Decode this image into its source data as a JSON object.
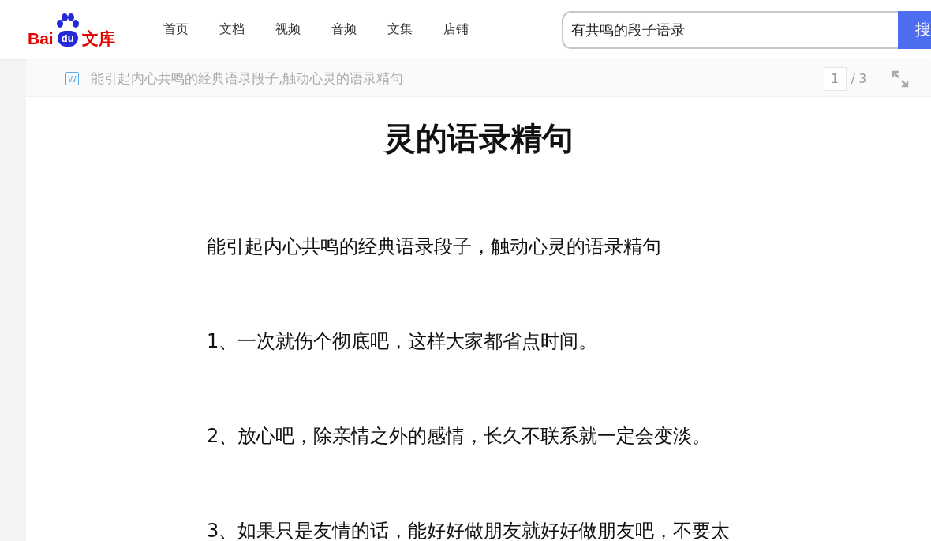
{
  "logo": {
    "latin": "Bai",
    "paw_text": "du",
    "name": "文库"
  },
  "nav": [
    {
      "label": "首页"
    },
    {
      "label": "文档"
    },
    {
      "label": "视频"
    },
    {
      "label": "音频"
    },
    {
      "label": "文集"
    },
    {
      "label": "店铺"
    }
  ],
  "search": {
    "value": "有共鸣的段子语录",
    "button": "搜"
  },
  "doc_bar": {
    "file_badge": "W",
    "title": "能引起内心共鸣的经典语录段子,触动心灵的语录精句",
    "page": "1",
    "pages": "/ 3"
  },
  "document": {
    "heading": "灵的语录精句",
    "paragraphs": [
      "能引起内心共鸣的经典语录段子，触动心灵的语录精句",
      "1、一次就伤个彻底吧，这样大家都省点时间。",
      "2、放心吧，除亲情之外的感情，长久不联系就一定会变淡。",
      "3、如果只是友情的话，能好好做朋友就好好做朋友吧，不要太"
    ]
  }
}
